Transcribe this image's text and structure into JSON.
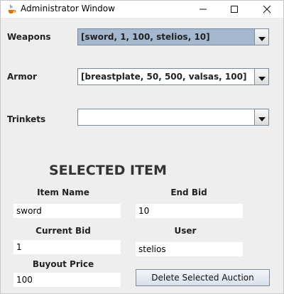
{
  "window": {
    "title": "Administrator Window"
  },
  "categories": {
    "weapons": {
      "label": "Weapons",
      "selected": "[sword, 1, 100, stelios, 10]"
    },
    "armor": {
      "label": "Armor",
      "selected": "[breastplate, 50, 500, valsas, 100]"
    },
    "trinkets": {
      "label": "Trinkets",
      "selected": ""
    }
  },
  "selected_item": {
    "heading": "SELECTED ITEM",
    "item_name": {
      "label": "Item Name",
      "value": "sword"
    },
    "end_bid": {
      "label": "End Bid",
      "value": "10"
    },
    "current_bid": {
      "label": "Current Bid",
      "value": "1"
    },
    "user": {
      "label": "User",
      "value": "stelios"
    },
    "buyout_price": {
      "label": "Buyout Price",
      "value": "100"
    }
  },
  "actions": {
    "delete_label": "Delete Selected Auction"
  },
  "colors": {
    "selected_combo": "#a4b8cf",
    "window_bg": "#eeeeee"
  },
  "icons": {
    "app": "java-coffee-cup-icon",
    "minimize": "minimize-icon",
    "maximize": "maximize-icon",
    "close": "close-icon",
    "dropdown": "triangle-down-icon"
  }
}
